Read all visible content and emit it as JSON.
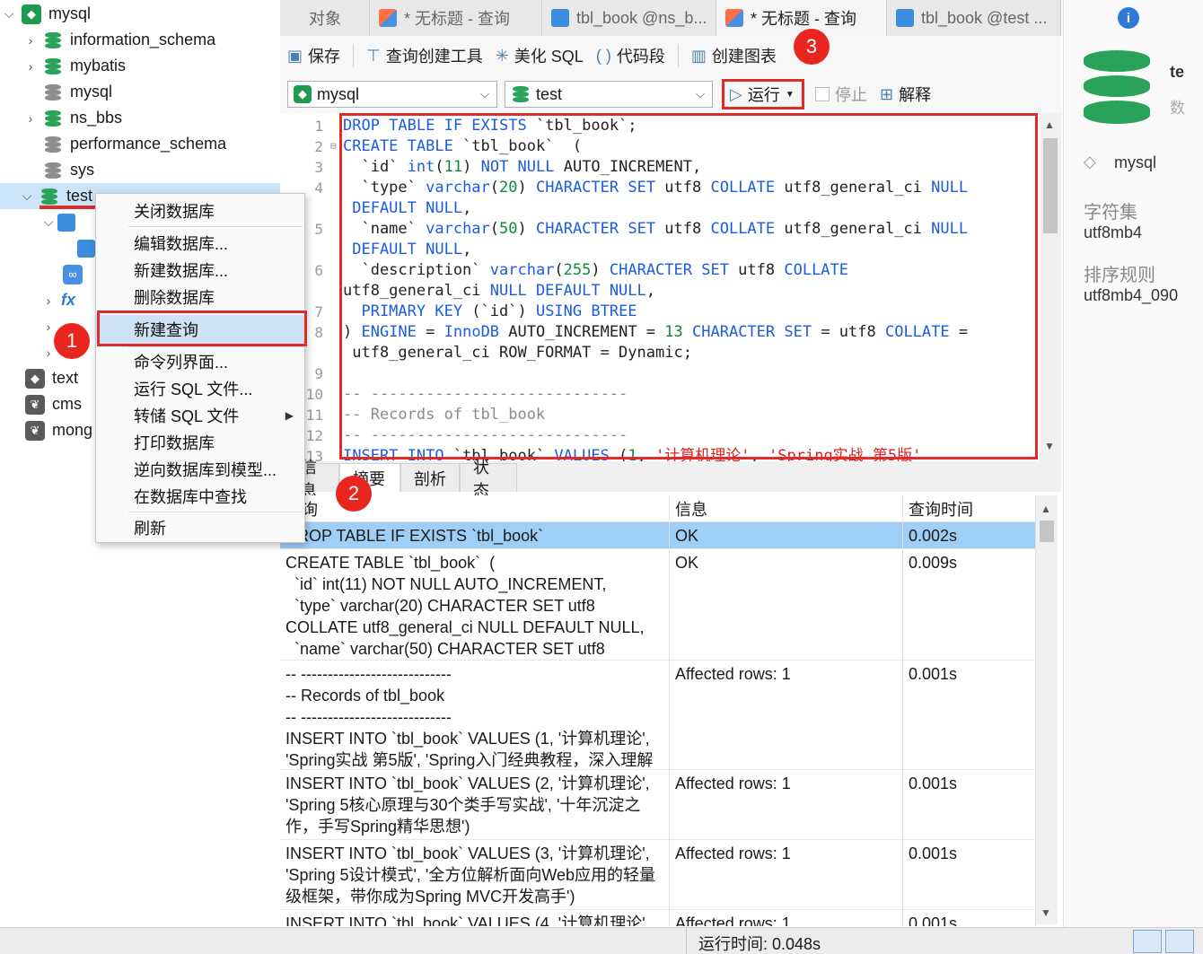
{
  "tree": {
    "connection": "mysql",
    "databases": [
      {
        "name": "information_schema",
        "color": "green"
      },
      {
        "name": "mybatis",
        "color": "green"
      },
      {
        "name": "mysql",
        "color": "gray"
      },
      {
        "name": "ns_bbs",
        "color": "green"
      },
      {
        "name": "performance_schema",
        "color": "gray"
      },
      {
        "name": "sys",
        "color": "gray"
      },
      {
        "name": "test",
        "color": "green"
      }
    ],
    "other_connections": [
      "text",
      "cms",
      "mong"
    ]
  },
  "tabs": [
    {
      "label": "对象",
      "icon": "none"
    },
    {
      "label": "* 无标题 - 查询",
      "icon": "query"
    },
    {
      "label": "tbl_book @ns_b...",
      "icon": "table"
    },
    {
      "label": "* 无标题 - 查询",
      "icon": "query"
    },
    {
      "label": "tbl_book @test ...",
      "icon": "table"
    }
  ],
  "toolbar": {
    "save": "保存",
    "query_builder": "查询创建工具",
    "beautify": "美化 SQL",
    "snippet": "代码段",
    "chart": "创建图表"
  },
  "toolbar2": {
    "connection_select": "mysql",
    "database_select": "test",
    "run": "运行",
    "stop": "停止",
    "explain": "解释"
  },
  "editor": {
    "line_numbers": [
      "1",
      "2",
      "3",
      "4",
      "5",
      "6",
      "7",
      "8",
      "9",
      "10",
      "11",
      "12",
      "13"
    ]
  },
  "result_tabs": [
    "信息",
    "摘要",
    "剖析",
    "状态"
  ],
  "grid": {
    "columns": [
      "查询",
      "信息",
      "查询时间"
    ],
    "rows": [
      {
        "query": "DROP TABLE IF EXISTS `tbl_book`",
        "info": "OK",
        "time": "0.002s"
      },
      {
        "query": "CREATE TABLE `tbl_book`  (\n  `id` int(11) NOT NULL AUTO_INCREMENT,\n  `type` varchar(20) CHARACTER SET utf8\nCOLLATE utf8_general_ci NULL DEFAULT NULL,\n  `name` varchar(50) CHARACTER SET utf8",
        "info": "OK",
        "time": "0.009s"
      },
      {
        "query": "-- ----------------------------\n-- Records of tbl_book\n-- ----------------------------\nINSERT INTO `tbl_book` VALUES (1, '计算机理论',\n'Spring实战 第5版', 'Spring入门经典教程，深入理解",
        "info": "Affected rows: 1",
        "time": "0.001s"
      },
      {
        "query": "INSERT INTO `tbl_book` VALUES (2, '计算机理论',\n'Spring 5核心原理与30个类手写实战', '十年沉淀之\n作，手写Spring精华思想')",
        "info": "Affected rows: 1",
        "time": "0.001s"
      },
      {
        "query": "INSERT INTO `tbl_book` VALUES (3, '计算机理论',\n'Spring 5设计模式', '全方位解析面向Web应用的轻量\n级框架，带你成为Spring MVC开发高手')",
        "info": "Affected rows: 1",
        "time": "0.001s"
      },
      {
        "query": "INSERT INTO `tbl_book` VALUES (4, '计算机理论',",
        "info": "Affected rows: 1",
        "time": "0.001s"
      }
    ]
  },
  "right_panel": {
    "title": "te",
    "subtitle": "数",
    "connection": "mysql",
    "charset_label": "字符集",
    "charset_value": "utf8mb4",
    "collation_label": "排序规则",
    "collation_value": "utf8mb4_090"
  },
  "context_menu": {
    "items": [
      "关闭数据库",
      "编辑数据库...",
      "新建数据库...",
      "删除数据库",
      "新建查询",
      "命令列界面...",
      "运行 SQL 文件...",
      "转储 SQL 文件",
      "打印数据库",
      "逆向数据库到模型...",
      "在数据库中查找",
      "刷新"
    ]
  },
  "markers": [
    "1",
    "2",
    "3"
  ],
  "status": {
    "runtime": "运行时间: 0.048s"
  },
  "colors": {
    "accent_red": "#e02b2b",
    "keyword_blue": "#1c5ce0",
    "number_green": "#0b8a3a",
    "selected_row": "#9fcff7"
  }
}
